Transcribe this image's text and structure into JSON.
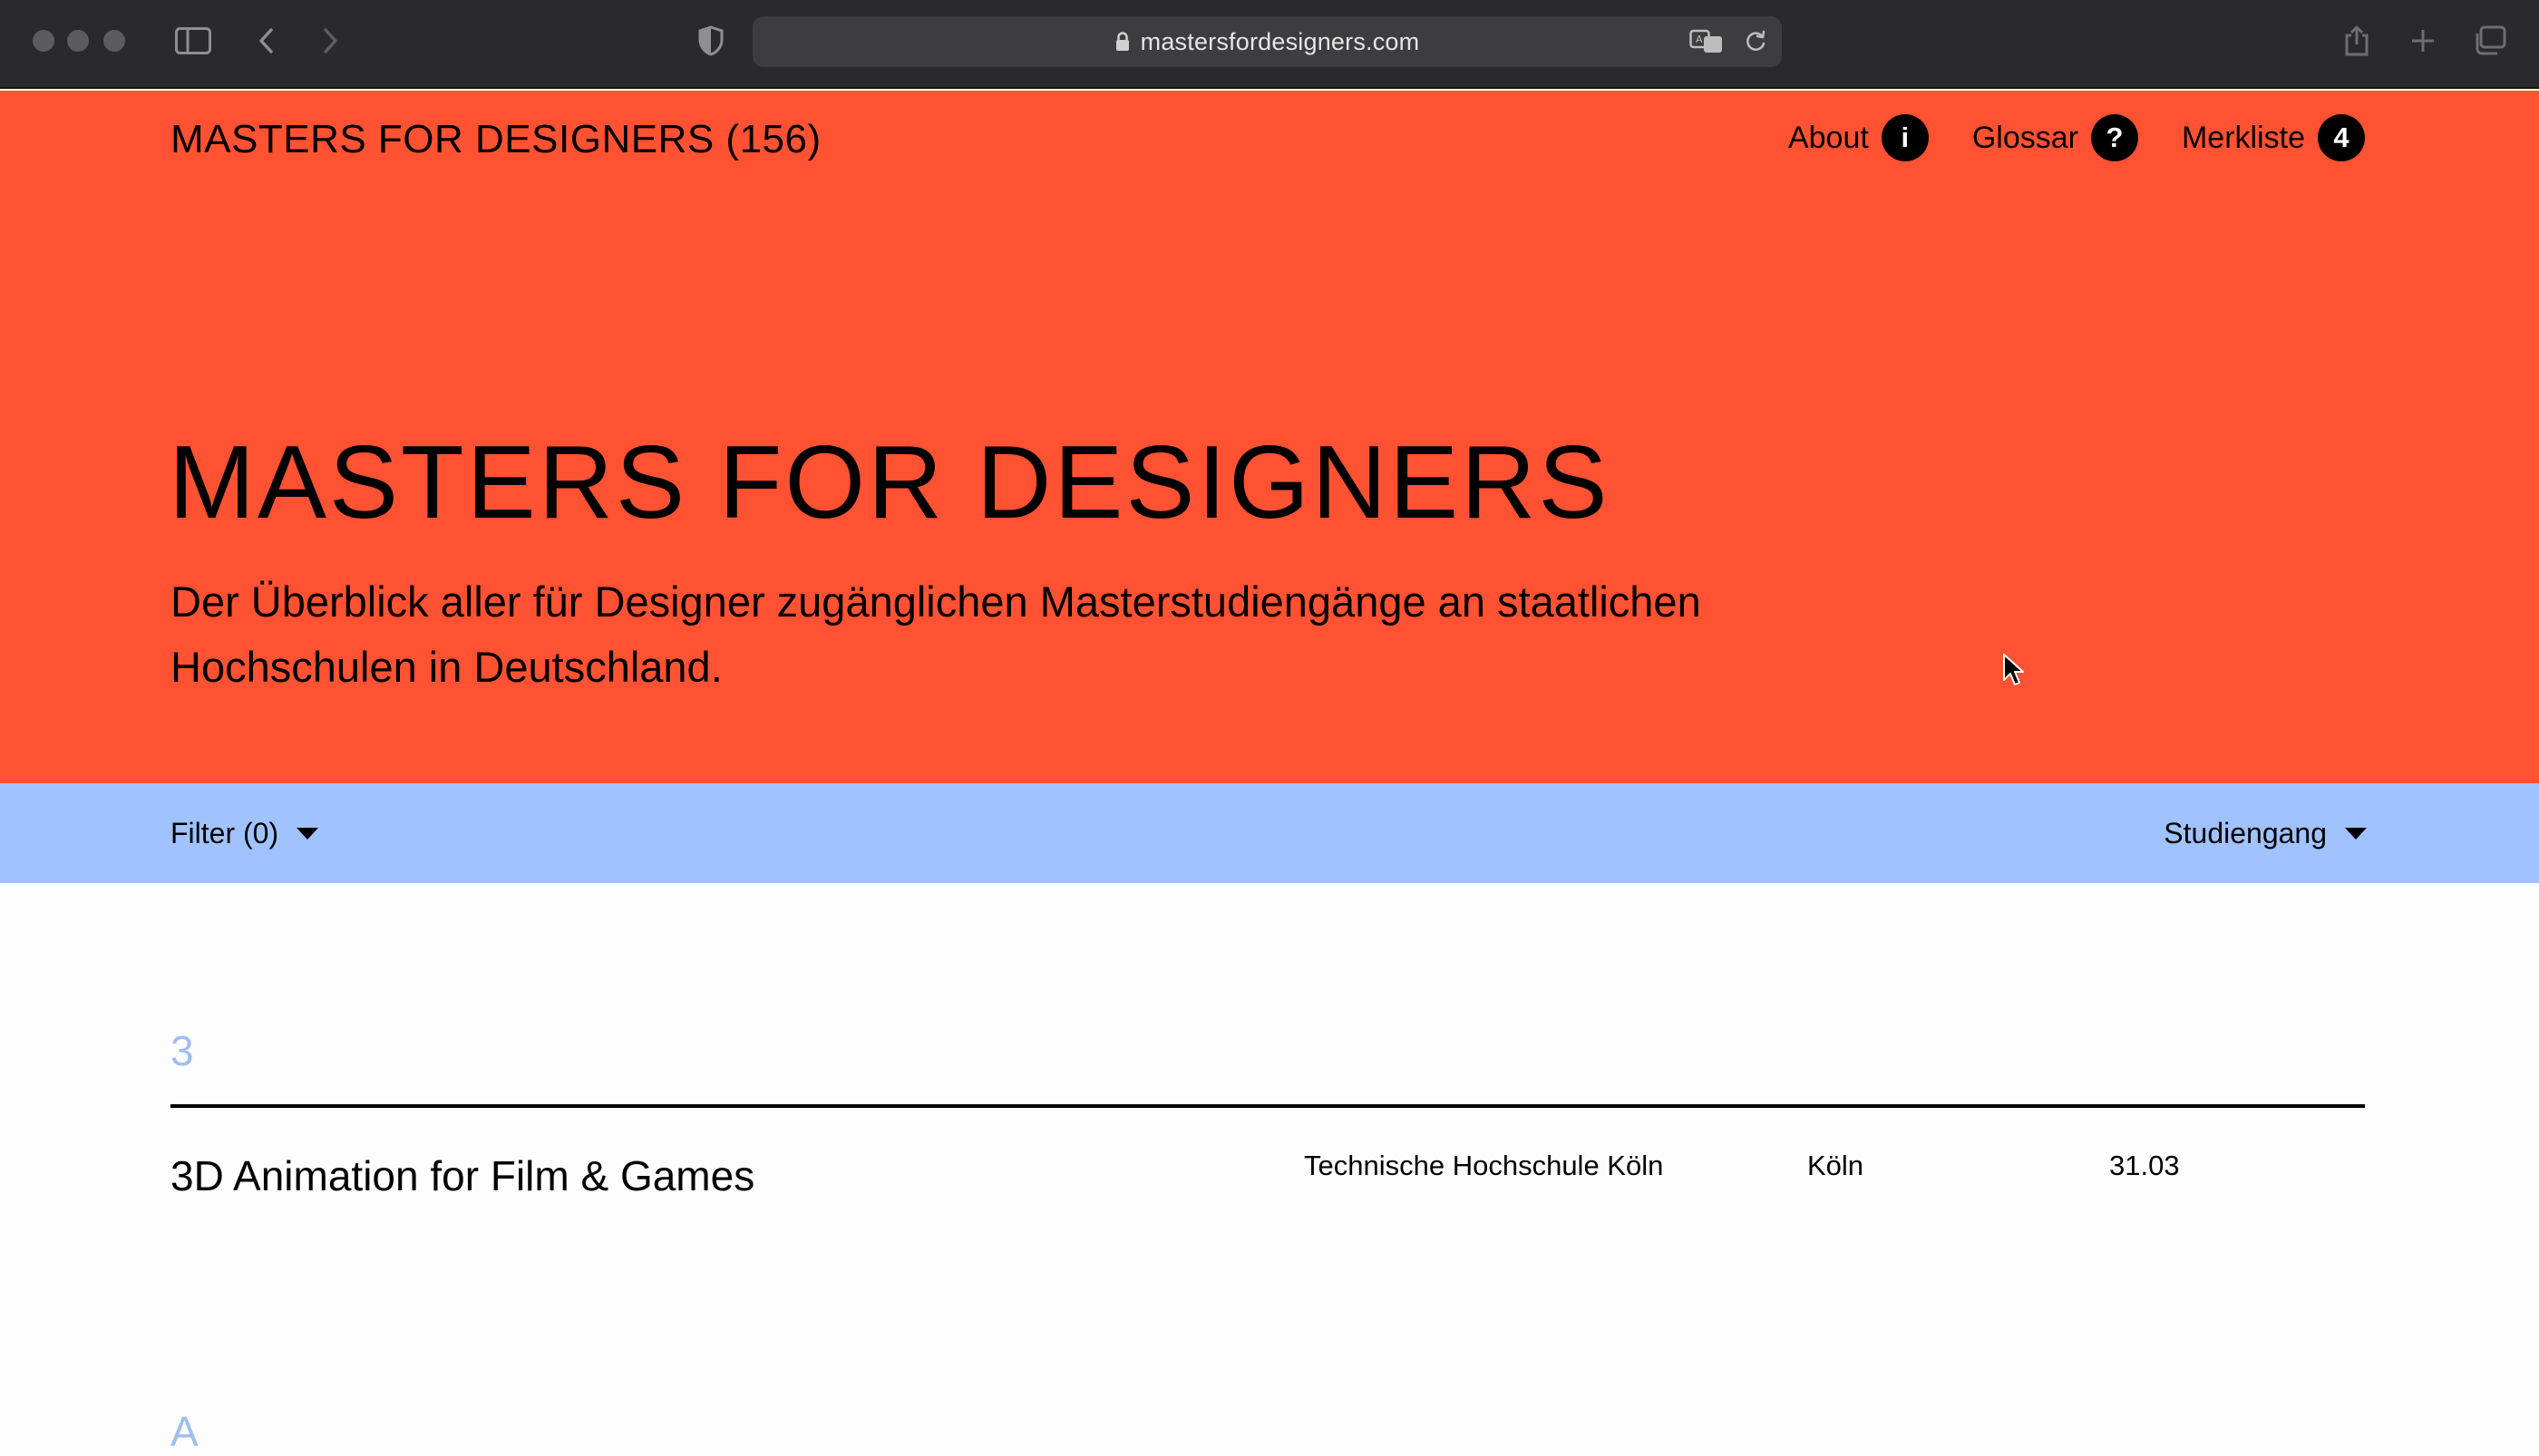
{
  "browser": {
    "url": "mastersfordesigners.com"
  },
  "header": {
    "site_title": "MASTERS FOR DESIGNERS (156)",
    "nav": [
      {
        "label": "About",
        "badge": "i"
      },
      {
        "label": "Glossar",
        "badge": "?"
      },
      {
        "label": "Merkliste",
        "badge": "4"
      }
    ]
  },
  "hero": {
    "heading": "MASTERS FOR DESIGNERS",
    "subtitle": "Der Überblick aller für Designer zugänglichen Masterstudiengänge an staatlichen Hochschulen in Deutschland."
  },
  "filterbar": {
    "filter_label": "Filter (0)",
    "sort_label": "Studiengang"
  },
  "listing": {
    "sections": [
      {
        "letter": "3",
        "rows": [
          {
            "name": "3D Animation for Film & Games",
            "school": "Technische Hochschule Köln",
            "city": "Köln",
            "date": "31.03"
          }
        ]
      },
      {
        "letter": "A",
        "rows": []
      }
    ]
  },
  "colors": {
    "hero_bg": "#ff5233",
    "filterbar_bg": "#a0c3ff",
    "section_letter": "#9fbdf2",
    "chrome_bg": "#2a2a2c"
  }
}
